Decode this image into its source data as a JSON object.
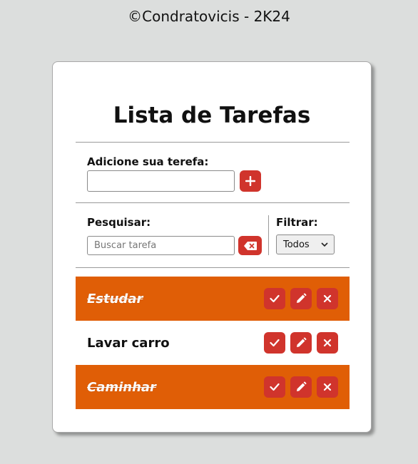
{
  "credit": "©Condratovicis - 2K24",
  "title": "Lista de Tarefas",
  "add": {
    "label": "Adicione sua terefa:",
    "value": "",
    "placeholder": ""
  },
  "search": {
    "label": "Pesquisar:",
    "value": "",
    "placeholder": "Buscar tarefa"
  },
  "filter": {
    "label": "Filtrar:",
    "selected": "Todos"
  },
  "todos": [
    {
      "text": "Estudar",
      "done": true
    },
    {
      "text": "Lavar carro",
      "done": false
    },
    {
      "text": "Caminhar",
      "done": true
    }
  ],
  "icons": {
    "add": "plus-icon",
    "clear_search": "backspace-icon",
    "finish": "check-icon",
    "edit": "pencil-icon",
    "remove": "close-icon"
  },
  "colors": {
    "accent": "#d0342c",
    "done_row": "#e05e06",
    "background": "#dcdedd"
  }
}
